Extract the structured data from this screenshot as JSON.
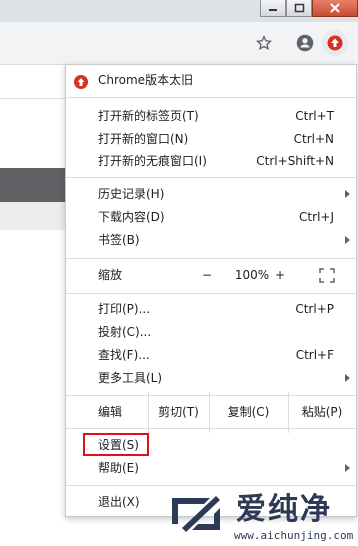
{
  "window": {
    "controls": [
      "minimize-icon",
      "maximize-icon",
      "close-icon"
    ]
  },
  "toolbar": {
    "icons": [
      "star-icon",
      "account-icon",
      "update-available-icon"
    ]
  },
  "menu": {
    "update_label": "Chrome版本太旧",
    "group1": [
      {
        "label": "打开新的标签页(T)",
        "shortcut": "Ctrl+T"
      },
      {
        "label": "打开新的窗口(N)",
        "shortcut": "Ctrl+N"
      },
      {
        "label": "打开新的无痕窗口(I)",
        "shortcut": "Ctrl+Shift+N"
      }
    ],
    "group2": [
      {
        "label": "历史记录(H)",
        "shortcut": ""
      },
      {
        "label": "下载内容(D)",
        "shortcut": "Ctrl+J"
      },
      {
        "label": "书签(B)",
        "shortcut": ""
      }
    ],
    "zoom": {
      "label": "缩放",
      "minus": "−",
      "value": "100%",
      "plus": "+"
    },
    "group3": [
      {
        "label": "打印(P)...",
        "shortcut": "Ctrl+P"
      },
      {
        "label": "投射(C)...",
        "shortcut": ""
      },
      {
        "label": "查找(F)...",
        "shortcut": "Ctrl+F"
      },
      {
        "label": "更多工具(L)",
        "shortcut": ""
      }
    ],
    "edit": {
      "label": "编辑",
      "cut": "剪切(T)",
      "copy": "复制(C)",
      "paste": "粘贴(P)"
    },
    "settings": {
      "label": "设置(S)"
    },
    "help": {
      "label": "帮助(E)"
    },
    "exit": {
      "label": "退出(X)"
    },
    "highlight_color": "#e0101a"
  },
  "watermark": {
    "title": "爱纯净",
    "url": "www.aichunjing.com",
    "color": "#2d3a56"
  }
}
